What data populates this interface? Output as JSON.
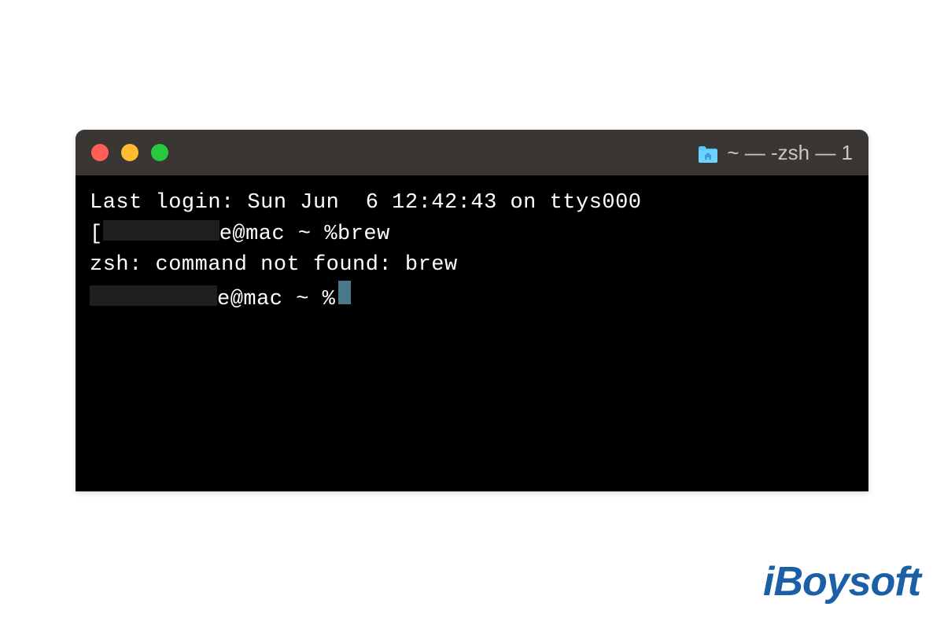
{
  "window": {
    "title_prefix": "~ — -zsh — 1"
  },
  "terminal": {
    "line1": "Last login: Sun Jun  6 12:42:43 on ttys000",
    "line2_bracket": "[",
    "line2_prompt": "e@mac ~ % ",
    "line2_command": "brew",
    "line3": "zsh: command not found: brew",
    "line4_prompt": "e@mac ~ % "
  },
  "watermark": {
    "text": "iBoysoft"
  }
}
